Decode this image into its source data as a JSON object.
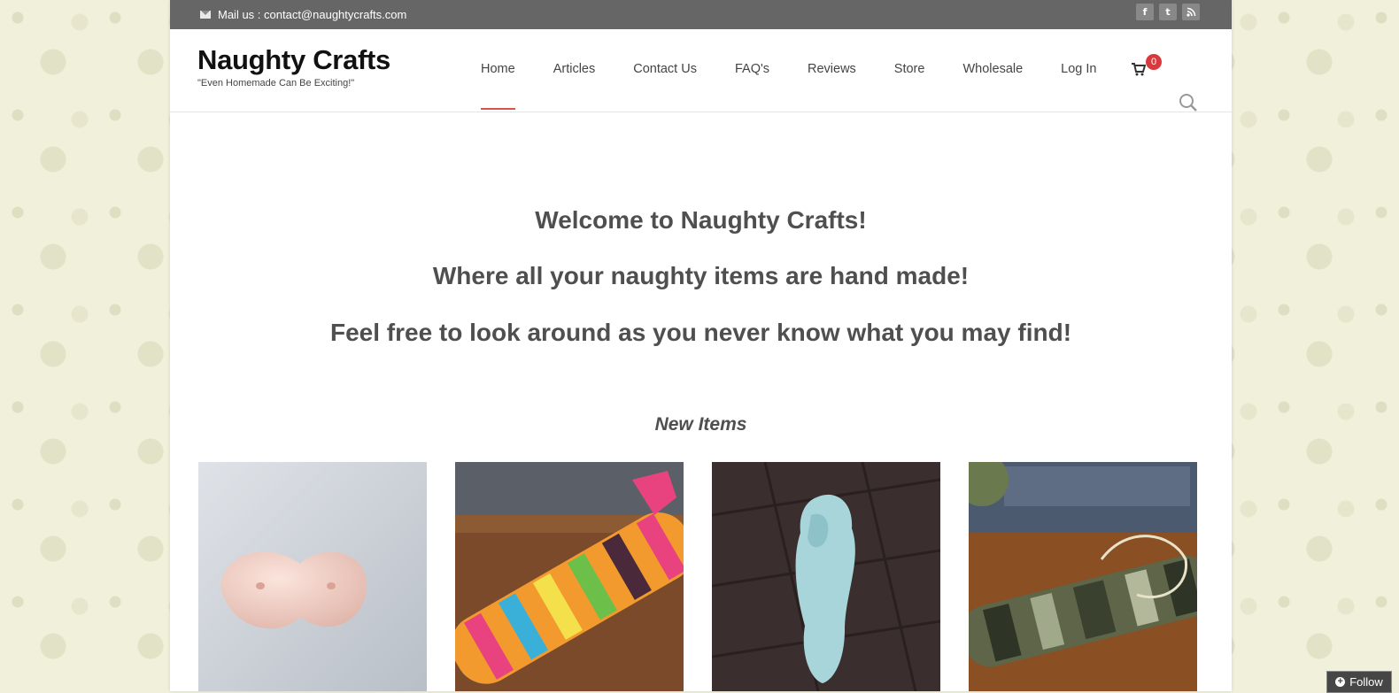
{
  "topbar": {
    "mail_label": "Mail us : contact@naughtycrafts.com",
    "social": [
      "facebook-icon",
      "twitter-icon",
      "rss-icon"
    ]
  },
  "header": {
    "title": "Naughty Crafts",
    "tagline": "\"Even Homemade Can Be Exciting!\""
  },
  "nav": {
    "items": [
      "Home",
      "Articles",
      "Contact Us",
      "FAQ's",
      "Reviews",
      "Store",
      "Wholesale",
      "Log In"
    ],
    "active": "Home",
    "cart_count": "0"
  },
  "hero": {
    "line1": "Welcome to Naughty Crafts!",
    "line2": "Where all your naughty items are hand made!",
    "line3": "Feel free to look around as you never know what you may find!"
  },
  "new_items": {
    "title": "New Items",
    "images": [
      "pink-molded-item",
      "rainbow-crochet-item",
      "blue-figurine-item",
      "camo-crochet-item"
    ]
  },
  "follow": {
    "label": "Follow"
  },
  "colors": {
    "accent": "#d9534f",
    "badge": "#d9393d",
    "topbar": "#666666"
  }
}
